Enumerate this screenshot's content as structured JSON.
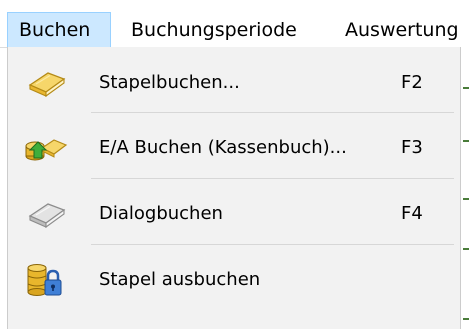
{
  "menubar": {
    "items": [
      {
        "label": "Buchen"
      },
      {
        "label": "Buchungsperiode"
      },
      {
        "label": "Auswertung"
      }
    ]
  },
  "menu": {
    "items": [
      {
        "label": "Stapelbuchen...",
        "shortcut": "F2",
        "icon": "yellow-book-icon"
      },
      {
        "label": "E/A Buchen (Kassenbuch)...",
        "shortcut": "F3",
        "icon": "coins-arrow-icon"
      },
      {
        "label": "Dialogbuchen",
        "shortcut": "F4",
        "icon": "gray-book-icon"
      },
      {
        "label": "Stapel ausbuchen",
        "shortcut": "",
        "icon": "database-lock-icon"
      }
    ]
  },
  "colors": {
    "menubar_highlight": "#cce8ff",
    "dropdown_background": "#f2f2f2",
    "separator": "#d7d7d7"
  }
}
